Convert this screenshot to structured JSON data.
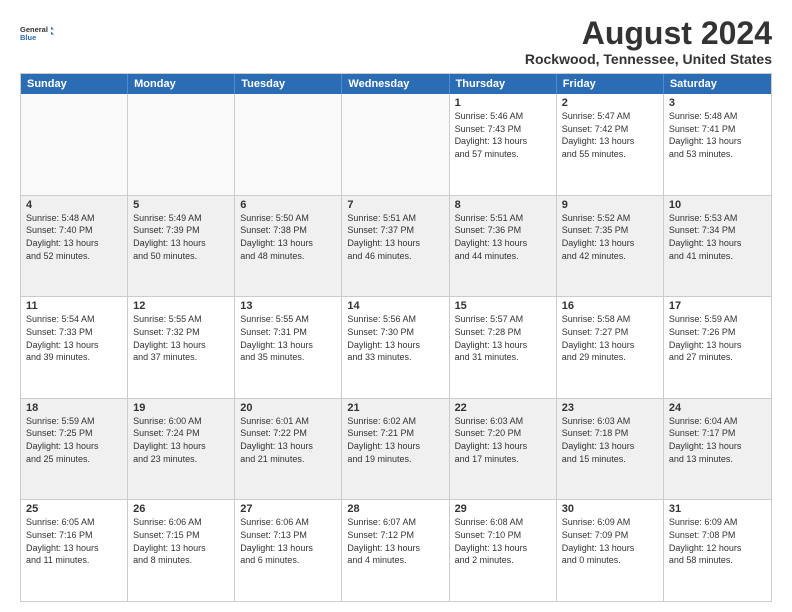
{
  "logo": {
    "general": "General",
    "blue": "Blue"
  },
  "header": {
    "title": "August 2024",
    "subtitle": "Rockwood, Tennessee, United States"
  },
  "weekdays": [
    "Sunday",
    "Monday",
    "Tuesday",
    "Wednesday",
    "Thursday",
    "Friday",
    "Saturday"
  ],
  "rows": [
    [
      {
        "day": "",
        "empty": true
      },
      {
        "day": "",
        "empty": true
      },
      {
        "day": "",
        "empty": true
      },
      {
        "day": "",
        "empty": true
      },
      {
        "day": "1",
        "info": "Sunrise: 5:46 AM\nSunset: 7:43 PM\nDaylight: 13 hours\nand 57 minutes."
      },
      {
        "day": "2",
        "info": "Sunrise: 5:47 AM\nSunset: 7:42 PM\nDaylight: 13 hours\nand 55 minutes."
      },
      {
        "day": "3",
        "info": "Sunrise: 5:48 AM\nSunset: 7:41 PM\nDaylight: 13 hours\nand 53 minutes."
      }
    ],
    [
      {
        "day": "4",
        "info": "Sunrise: 5:48 AM\nSunset: 7:40 PM\nDaylight: 13 hours\nand 52 minutes.",
        "shaded": true
      },
      {
        "day": "5",
        "info": "Sunrise: 5:49 AM\nSunset: 7:39 PM\nDaylight: 13 hours\nand 50 minutes.",
        "shaded": true
      },
      {
        "day": "6",
        "info": "Sunrise: 5:50 AM\nSunset: 7:38 PM\nDaylight: 13 hours\nand 48 minutes.",
        "shaded": true
      },
      {
        "day": "7",
        "info": "Sunrise: 5:51 AM\nSunset: 7:37 PM\nDaylight: 13 hours\nand 46 minutes.",
        "shaded": true
      },
      {
        "day": "8",
        "info": "Sunrise: 5:51 AM\nSunset: 7:36 PM\nDaylight: 13 hours\nand 44 minutes.",
        "shaded": true
      },
      {
        "day": "9",
        "info": "Sunrise: 5:52 AM\nSunset: 7:35 PM\nDaylight: 13 hours\nand 42 minutes.",
        "shaded": true
      },
      {
        "day": "10",
        "info": "Sunrise: 5:53 AM\nSunset: 7:34 PM\nDaylight: 13 hours\nand 41 minutes.",
        "shaded": true
      }
    ],
    [
      {
        "day": "11",
        "info": "Sunrise: 5:54 AM\nSunset: 7:33 PM\nDaylight: 13 hours\nand 39 minutes."
      },
      {
        "day": "12",
        "info": "Sunrise: 5:55 AM\nSunset: 7:32 PM\nDaylight: 13 hours\nand 37 minutes."
      },
      {
        "day": "13",
        "info": "Sunrise: 5:55 AM\nSunset: 7:31 PM\nDaylight: 13 hours\nand 35 minutes."
      },
      {
        "day": "14",
        "info": "Sunrise: 5:56 AM\nSunset: 7:30 PM\nDaylight: 13 hours\nand 33 minutes."
      },
      {
        "day": "15",
        "info": "Sunrise: 5:57 AM\nSunset: 7:28 PM\nDaylight: 13 hours\nand 31 minutes."
      },
      {
        "day": "16",
        "info": "Sunrise: 5:58 AM\nSunset: 7:27 PM\nDaylight: 13 hours\nand 29 minutes."
      },
      {
        "day": "17",
        "info": "Sunrise: 5:59 AM\nSunset: 7:26 PM\nDaylight: 13 hours\nand 27 minutes."
      }
    ],
    [
      {
        "day": "18",
        "info": "Sunrise: 5:59 AM\nSunset: 7:25 PM\nDaylight: 13 hours\nand 25 minutes.",
        "shaded": true
      },
      {
        "day": "19",
        "info": "Sunrise: 6:00 AM\nSunset: 7:24 PM\nDaylight: 13 hours\nand 23 minutes.",
        "shaded": true
      },
      {
        "day": "20",
        "info": "Sunrise: 6:01 AM\nSunset: 7:22 PM\nDaylight: 13 hours\nand 21 minutes.",
        "shaded": true
      },
      {
        "day": "21",
        "info": "Sunrise: 6:02 AM\nSunset: 7:21 PM\nDaylight: 13 hours\nand 19 minutes.",
        "shaded": true
      },
      {
        "day": "22",
        "info": "Sunrise: 6:03 AM\nSunset: 7:20 PM\nDaylight: 13 hours\nand 17 minutes.",
        "shaded": true
      },
      {
        "day": "23",
        "info": "Sunrise: 6:03 AM\nSunset: 7:18 PM\nDaylight: 13 hours\nand 15 minutes.",
        "shaded": true
      },
      {
        "day": "24",
        "info": "Sunrise: 6:04 AM\nSunset: 7:17 PM\nDaylight: 13 hours\nand 13 minutes.",
        "shaded": true
      }
    ],
    [
      {
        "day": "25",
        "info": "Sunrise: 6:05 AM\nSunset: 7:16 PM\nDaylight: 13 hours\nand 11 minutes."
      },
      {
        "day": "26",
        "info": "Sunrise: 6:06 AM\nSunset: 7:15 PM\nDaylight: 13 hours\nand 8 minutes."
      },
      {
        "day": "27",
        "info": "Sunrise: 6:06 AM\nSunset: 7:13 PM\nDaylight: 13 hours\nand 6 minutes."
      },
      {
        "day": "28",
        "info": "Sunrise: 6:07 AM\nSunset: 7:12 PM\nDaylight: 13 hours\nand 4 minutes."
      },
      {
        "day": "29",
        "info": "Sunrise: 6:08 AM\nSunset: 7:10 PM\nDaylight: 13 hours\nand 2 minutes."
      },
      {
        "day": "30",
        "info": "Sunrise: 6:09 AM\nSunset: 7:09 PM\nDaylight: 13 hours\nand 0 minutes."
      },
      {
        "day": "31",
        "info": "Sunrise: 6:09 AM\nSunset: 7:08 PM\nDaylight: 12 hours\nand 58 minutes."
      }
    ]
  ]
}
